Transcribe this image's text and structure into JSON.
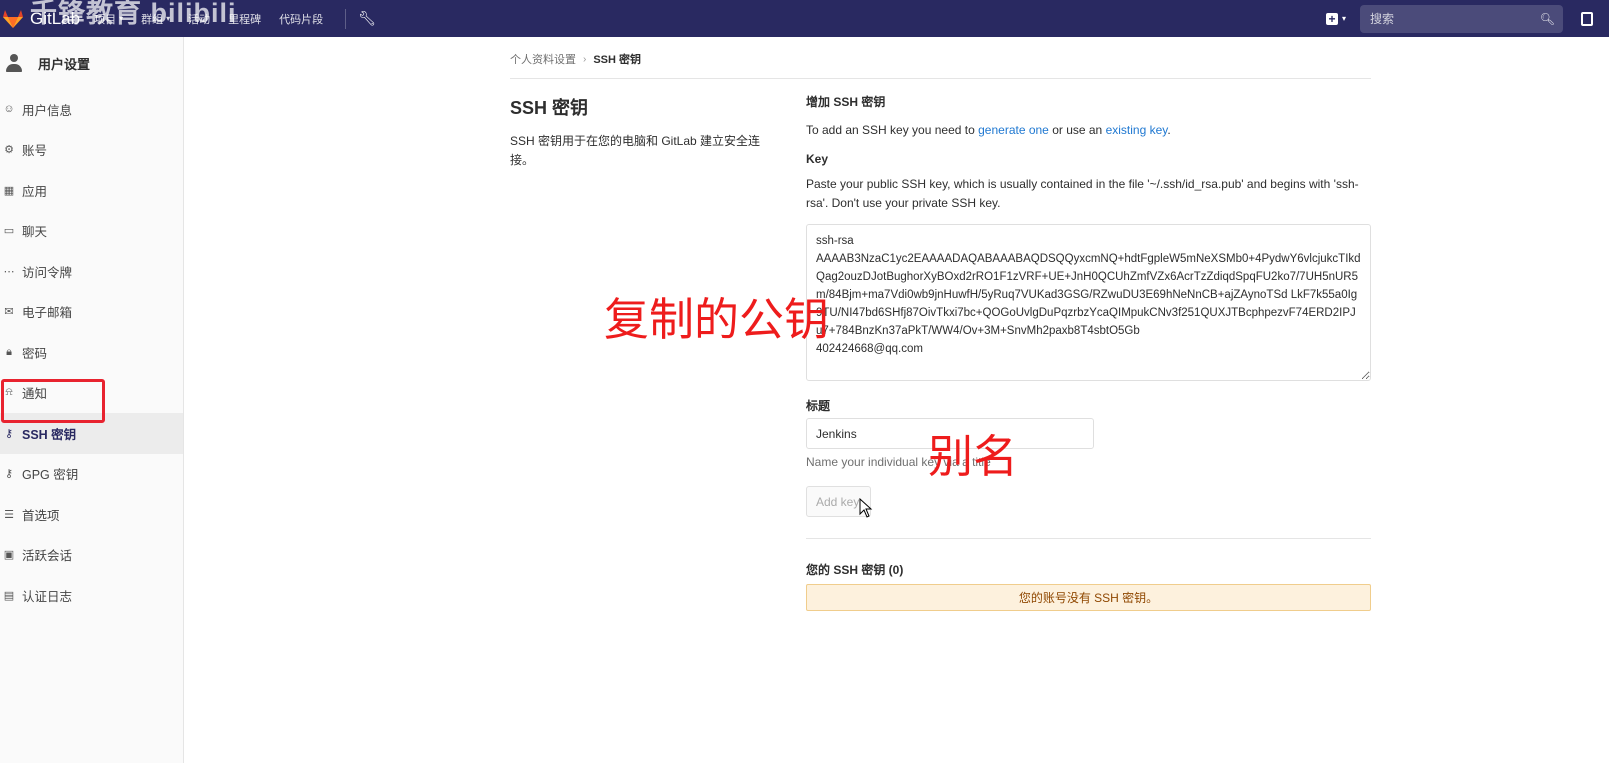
{
  "navbar": {
    "brand": "GitLab",
    "watermark": "千锋教育 bilibili",
    "menu": [
      {
        "label": "项目",
        "has_dropdown": true
      },
      {
        "label": "群组",
        "has_dropdown": true
      },
      {
        "label": "活动",
        "has_dropdown": false
      },
      {
        "label": "里程碑",
        "has_dropdown": false
      },
      {
        "label": "代码片段",
        "has_dropdown": false
      }
    ],
    "search_placeholder": "搜索",
    "colors": {
      "background": "#292961",
      "logo": "#e24329"
    }
  },
  "sidebar": {
    "title": "用户设置",
    "items": [
      {
        "label": "用户信息",
        "icon": "profile-icon",
        "glyph": "☺",
        "active": false
      },
      {
        "label": "账号",
        "icon": "account-icon",
        "glyph": "⚙",
        "active": false
      },
      {
        "label": "应用",
        "icon": "applications-icon",
        "glyph": "▦",
        "active": false
      },
      {
        "label": "聊天",
        "icon": "chat-icon",
        "glyph": "▭",
        "active": false
      },
      {
        "label": "访问令牌",
        "icon": "token-icon",
        "glyph": "⋯",
        "active": false
      },
      {
        "label": "电子邮箱",
        "icon": "mail-icon",
        "glyph": "✉",
        "active": false
      },
      {
        "label": "密码",
        "icon": "lock-icon",
        "glyph": "🔒︎",
        "active": false
      },
      {
        "label": "通知",
        "icon": "bell-icon",
        "glyph": "⍾",
        "active": false
      },
      {
        "label": "SSH 密钥",
        "icon": "key-icon",
        "glyph": "⚷",
        "active": true
      },
      {
        "label": "GPG 密钥",
        "icon": "key-icon",
        "glyph": "⚷",
        "active": false
      },
      {
        "label": "首选项",
        "icon": "preferences-icon",
        "glyph": "☰",
        "active": false
      },
      {
        "label": "活跃会话",
        "icon": "monitor-icon",
        "glyph": "▣",
        "active": false
      },
      {
        "label": "认证日志",
        "icon": "log-icon",
        "glyph": "▤",
        "active": false
      }
    ],
    "active_color": "#292961"
  },
  "breadcrumb": {
    "parent": "个人资料设置",
    "current": "SSH 密钥"
  },
  "page": {
    "title": "SSH 密钥",
    "description": "SSH 密钥用于在您的电脑和 GitLab 建立安全连接。"
  },
  "form": {
    "section_title": "增加 SSH 密钥",
    "intro_prefix": "To add an SSH key you need to ",
    "generate_link": "generate one",
    "intro_middle": " or use an ",
    "existing_link": "existing key",
    "intro_suffix": ".",
    "key_label": "Key",
    "key_help": "Paste your public SSH key, which is usually contained in the file '~/.ssh/id_rsa.pub' and begins with 'ssh-rsa'. Don't use your private SSH key.",
    "key_value": "ssh-rsa\nAAAAB3NzaC1yc2EAAAADAQABAAABAQDSQQyxcmNQ+hdtFgpleW5mNeXSMb0+4PydwY6vlcjukcTIkdQag2ouzDJotBughorXyBOxd2rRO1F1zVRF+UE+JnH0QCUhZmfVZx6AcrTzZdiqdSpqFU2ko7/7UH5nUR5m/84Bjm+ma7Vdi0wb9jnHuwfH/5yRuq7VUKad3GSG/RZwuDU3E69hNeNnCB+ajZAynoTSd LkF7k55a0Ig9TU/NI47bd6SHfj87OivTkxi7bc+QOGoUvlgDuPqzrbzYcaQIMpukCNv3f251QUXJTBcphpezvF74ERD2IPJu7+784BnzKn37aPkT/WW4/Ov+3M+SnvMh2paxb8T4sbtO5Gb\n402424668@qq.com",
    "title_label": "标题",
    "title_value": "Jenkins",
    "title_help": "Name your individual key via a title",
    "add_button": "Add key"
  },
  "keys_list": {
    "title": "您的 SSH 密钥 (0)",
    "empty_message": "您的账号没有 SSH 密钥。"
  },
  "annotations": {
    "public_key_note": "复制的公钥",
    "alias_note": "别名",
    "color": "#ee1c1c"
  }
}
